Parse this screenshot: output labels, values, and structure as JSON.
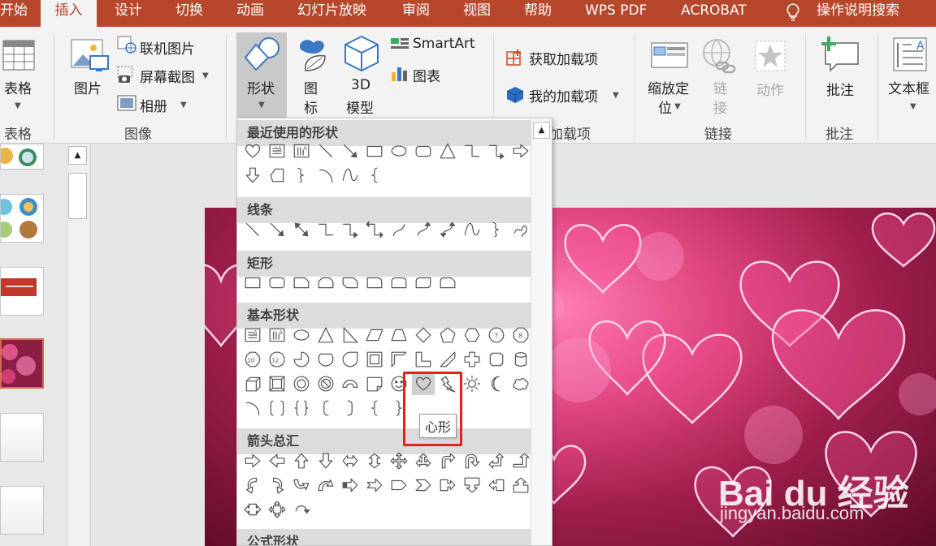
{
  "tabs": {
    "start": "开始",
    "insert": "插入",
    "design": "设计",
    "transition": "切换",
    "animation": "动画",
    "slideshow": "幻灯片放映",
    "review": "审阅",
    "view": "视图",
    "help": "帮助",
    "wps_pdf": "WPS PDF",
    "acrobat": "ACROBAT",
    "search": "操作说明搜索"
  },
  "ribbon": {
    "table": "表格",
    "table_group": "表格",
    "picture": "图片",
    "online_picture": "联机图片",
    "screenshot": "屏幕截图",
    "album": "相册",
    "images_group": "图像",
    "shapes": "形状",
    "icon_line1": "图",
    "icon_line2": "标",
    "model_line1": "3D",
    "model_line2": "模型",
    "smartart": "SmartArt",
    "chart": "图表",
    "get_addins": "获取加载项",
    "my_addins": "我的加载项",
    "addins_group_partial": "加载项",
    "zoom_line1": "缩放定",
    "zoom_line2": "位",
    "link_line1": "链",
    "link_line2": "接",
    "action": "动作",
    "links_group": "链接",
    "comment": "批注",
    "comments_group": "批注",
    "textbox": "文本框"
  },
  "dropdown": {
    "recent": "最近使用的形状",
    "lines": "线条",
    "rect": "矩形",
    "basic": "基本形状",
    "arrows": "箭头总汇",
    "formula": "公式形状",
    "ten": "10",
    "twelve": "12",
    "tooltip": "心形"
  },
  "watermark": {
    "brand": "Bai du 经验",
    "url": "jingyan.baidu.com"
  }
}
